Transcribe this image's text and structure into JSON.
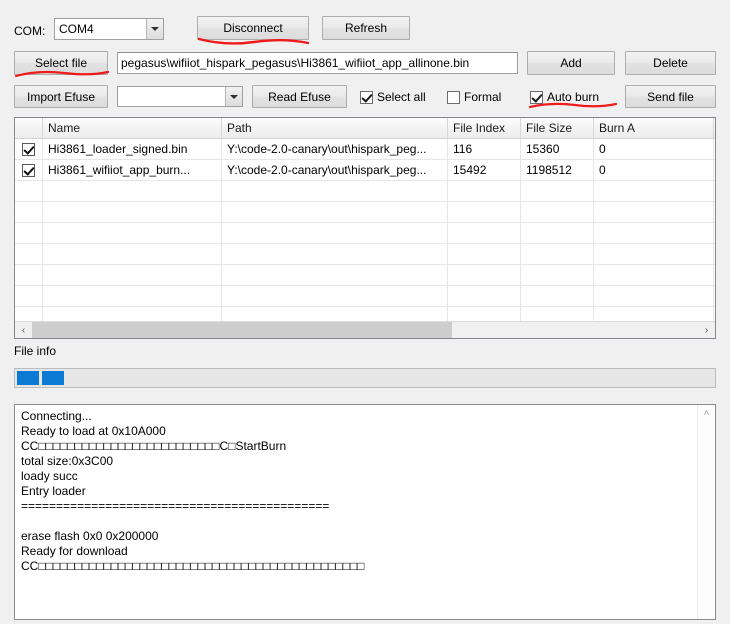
{
  "toolbar": {
    "com_label": "COM:",
    "com_value": "COM4",
    "disconnect_label": "Disconnect",
    "refresh_label": "Refresh",
    "select_file_label": "Select file",
    "path_value": "pegasus\\wifiiot_hispark_pegasus\\Hi3861_wifiiot_app_allinone.bin",
    "add_label": "Add",
    "delete_label": "Delete",
    "import_efuse_label": "Import Efuse",
    "efuse_value": "",
    "read_efuse_label": "Read Efuse",
    "select_all_label": "Select all",
    "select_all_checked": true,
    "formal_label": "Formal",
    "formal_checked": false,
    "auto_burn_label": "Auto burn",
    "auto_burn_checked": true,
    "send_file_label": "Send file"
  },
  "annotations": {
    "color": "#ee1b1b",
    "marks": [
      "disconnect-underline",
      "select-file-underline",
      "auto-burn-underline"
    ]
  },
  "grid": {
    "columns": [
      "",
      "Name",
      "Path",
      "File Index",
      "File Size",
      "Burn A"
    ],
    "rows": [
      {
        "checked": true,
        "name": "Hi3861_loader_signed.bin",
        "path": "Y:\\code-2.0-canary\\out\\hispark_peg...",
        "file_index": "116",
        "file_size": "15360",
        "burn_addr": "0"
      },
      {
        "checked": true,
        "name": "Hi3861_wifiiot_app_burn...",
        "path": "Y:\\code-2.0-canary\\out\\hispark_peg...",
        "file_index": "15492",
        "file_size": "1198512",
        "burn_addr": "0"
      }
    ],
    "empty_row_count": 7,
    "hscroll_thumb_percent": 63,
    "scroll_left_glyph": "‹",
    "scroll_right_glyph": "›"
  },
  "file_info": {
    "label": "File info",
    "progress_chunks": 2,
    "progress_color": "#0b7ad5"
  },
  "log": {
    "scroll_up_glyph": "˄",
    "text": "Connecting...\nReady to load at 0x10A000\nCC□□□□□□□□□□□□□□□□□□□□□□□□□C□StartBurn\ntotal size:0x3C00\nloady succ\nEntry loader\n============================================\n\nerase flash 0x0 0x200000\nReady for download\nCC□□□□□□□□□□□□□□□□□□□□□□□□□□□□□□□□□□□□□□□□□□□□□"
  }
}
